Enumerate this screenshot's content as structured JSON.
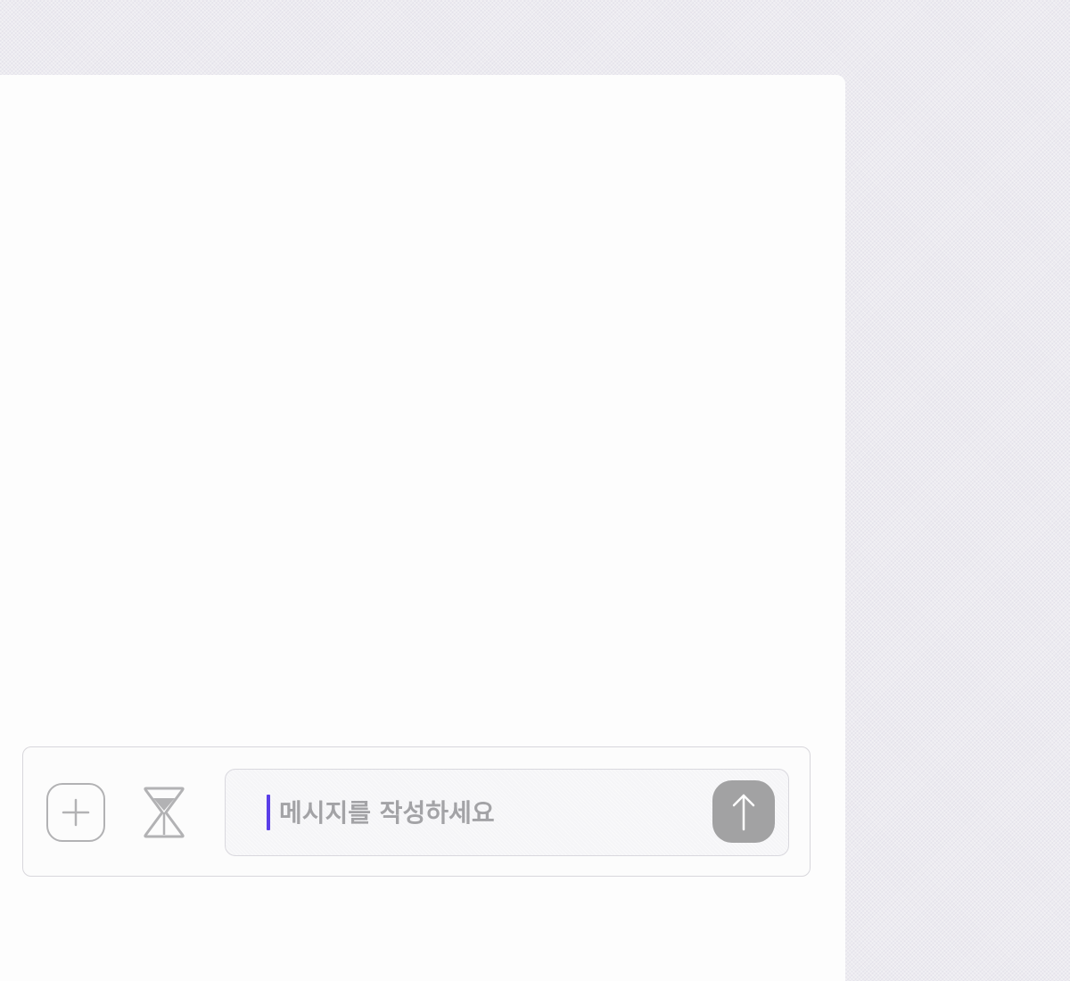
{
  "composer": {
    "input": {
      "value": "",
      "placeholder": "메시지를 작성하세요"
    },
    "buttons": {
      "add": {
        "icon": "plus-icon"
      },
      "timer": {
        "icon": "hourglass-icon"
      },
      "send": {
        "icon": "arrow-up-icon"
      }
    },
    "caret_color": "#5a3ee8",
    "send_button_color": "#a2a2a3"
  }
}
